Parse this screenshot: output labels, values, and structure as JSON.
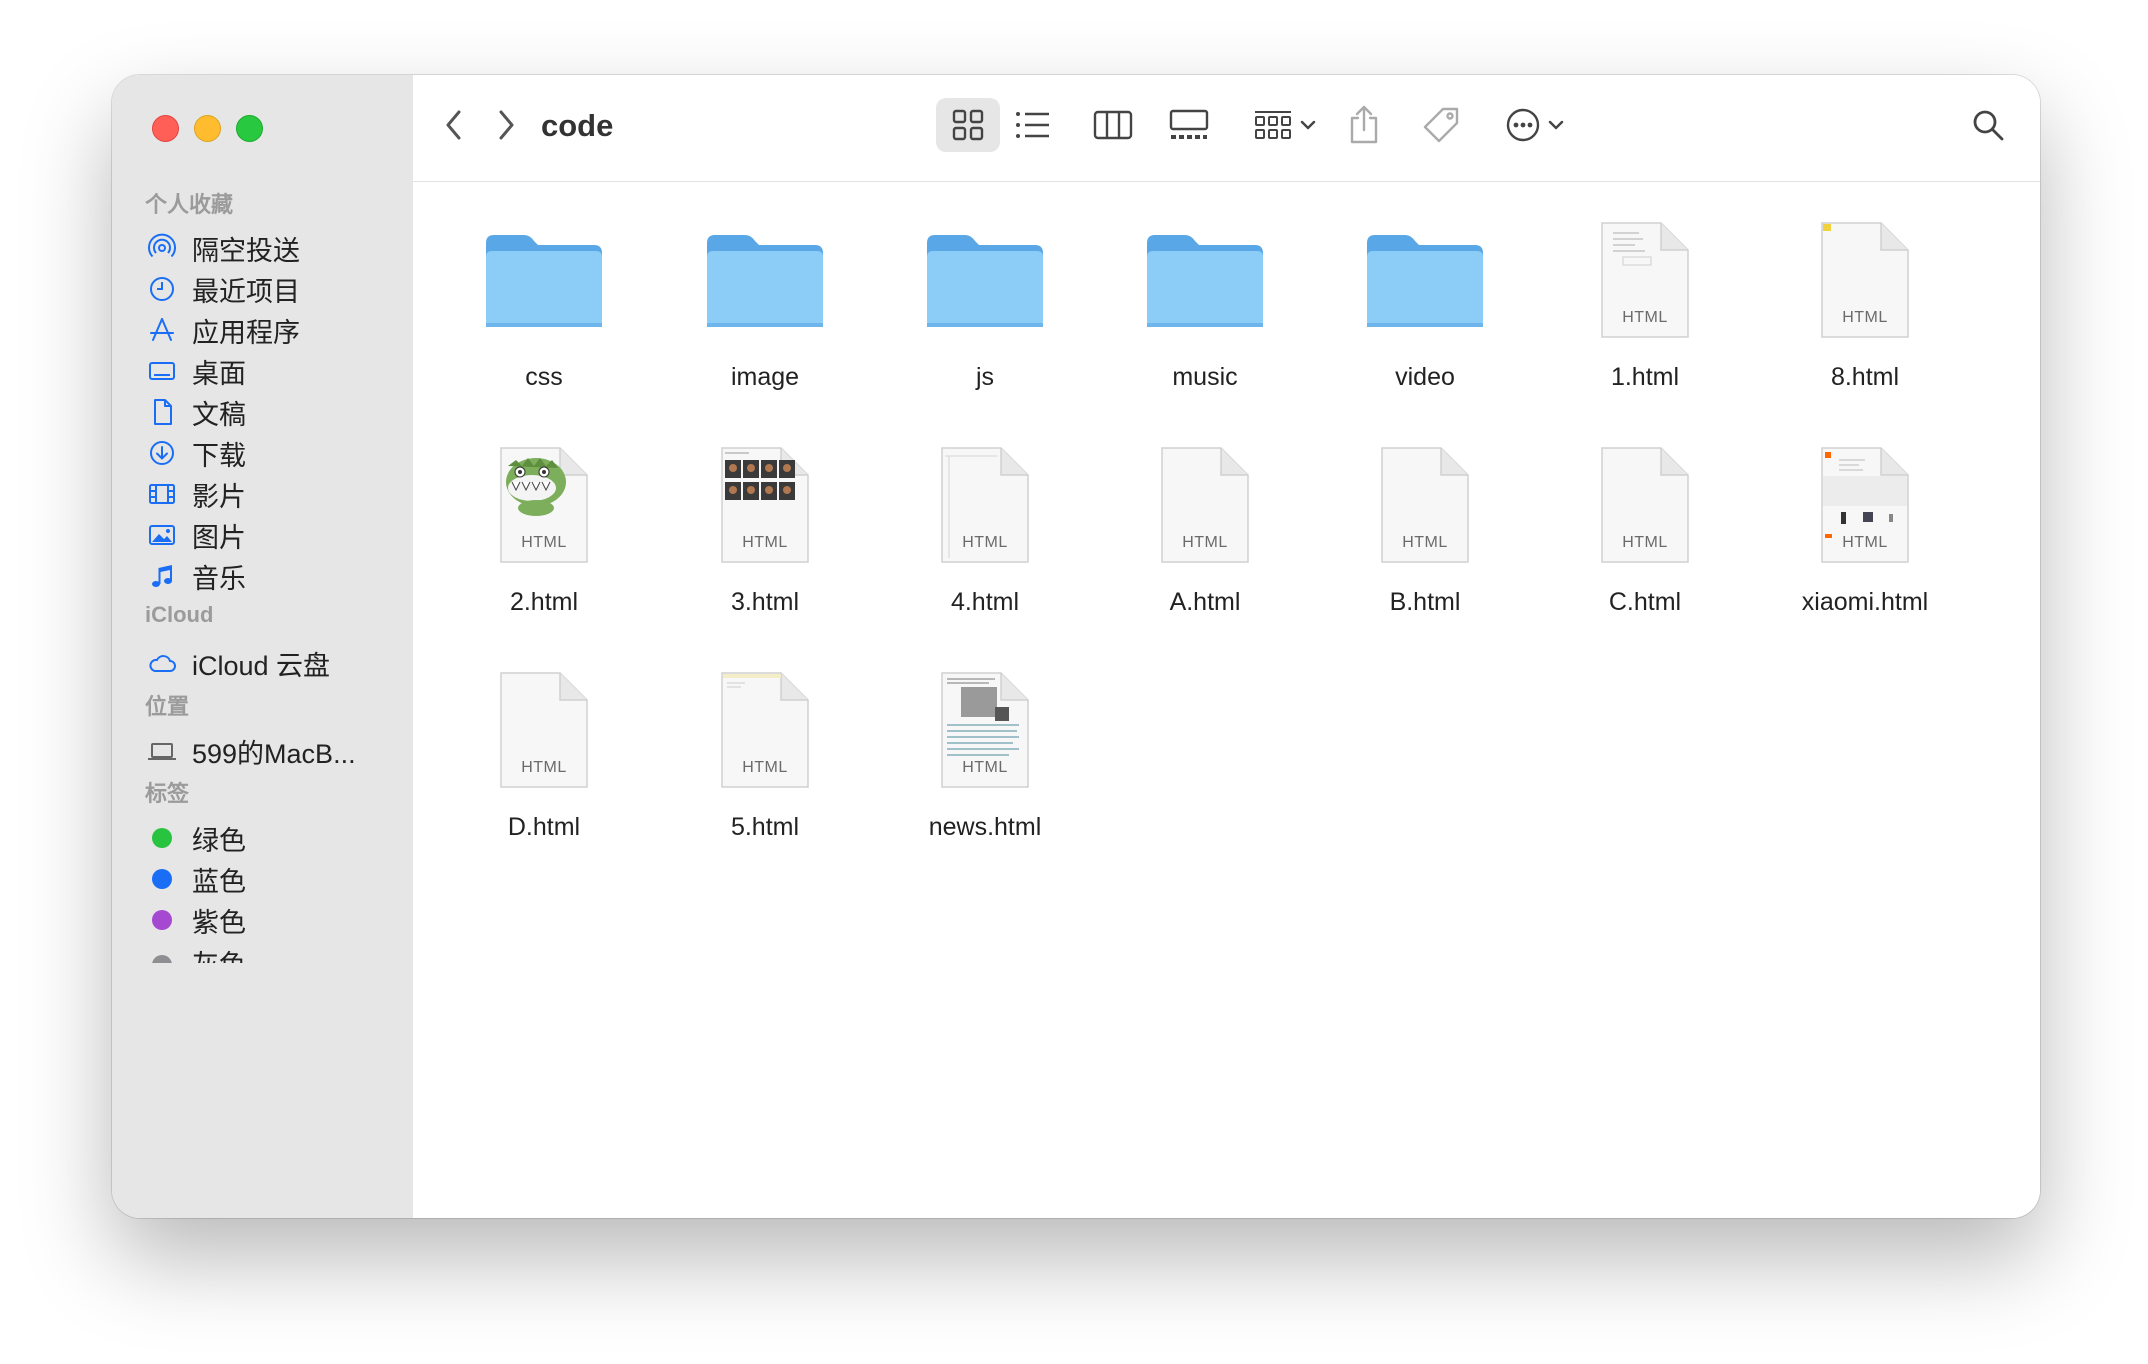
{
  "window": {
    "title": "code"
  },
  "sidebar": {
    "favorites_header": "个人收藏",
    "favorites": [
      {
        "label": "隔空投送",
        "icon": "airdrop-icon"
      },
      {
        "label": "最近项目",
        "icon": "clock-icon"
      },
      {
        "label": "应用程序",
        "icon": "applications-icon"
      },
      {
        "label": "桌面",
        "icon": "desktop-icon"
      },
      {
        "label": "文稿",
        "icon": "document-icon"
      },
      {
        "label": "下载",
        "icon": "download-icon"
      },
      {
        "label": "影片",
        "icon": "film-icon"
      },
      {
        "label": "图片",
        "icon": "photo-icon"
      },
      {
        "label": "音乐",
        "icon": "music-note-icon"
      }
    ],
    "icloud_header": "iCloud",
    "icloud": [
      {
        "label": "iCloud 云盘",
        "icon": "cloud-icon"
      }
    ],
    "locations_header": "位置",
    "locations": [
      {
        "label": "599的MacB...",
        "icon": "laptop-icon"
      }
    ],
    "tags_header": "标签",
    "tags": [
      {
        "label": "绿色",
        "color": "#28c33f"
      },
      {
        "label": "蓝色",
        "color": "#1a6ef5"
      },
      {
        "label": "紫色",
        "color": "#a549d1"
      },
      {
        "label": "灰色",
        "color": "#8e8e93"
      }
    ]
  },
  "toolbar": {
    "back_icon": "chevron-left-icon",
    "forward_icon": "chevron-right-icon",
    "path_title": "code",
    "views": [
      "icon-view-icon",
      "list-view-icon",
      "column-view-icon",
      "gallery-view-icon"
    ],
    "active_view": "icon-view-icon",
    "group_icon": "group-by-icon",
    "share_icon": "share-icon",
    "tag_icon": "tag-icon",
    "more_icon": "ellipsis-circle-icon",
    "search_icon": "search-icon"
  },
  "files": [
    {
      "name": "css",
      "kind": "folder"
    },
    {
      "name": "image",
      "kind": "folder"
    },
    {
      "name": "js",
      "kind": "folder"
    },
    {
      "name": "music",
      "kind": "folder"
    },
    {
      "name": "video",
      "kind": "folder"
    },
    {
      "name": "1.html",
      "kind": "html",
      "badge": "HTML",
      "preview": "text-lines"
    },
    {
      "name": "8.html",
      "kind": "html",
      "badge": "HTML",
      "preview": "yellow-corner"
    },
    {
      "name": "2.html",
      "kind": "html",
      "badge": "HTML",
      "preview": "dinosaur"
    },
    {
      "name": "3.html",
      "kind": "html",
      "badge": "HTML",
      "preview": "photo-grid"
    },
    {
      "name": "4.html",
      "kind": "html",
      "badge": "HTML",
      "preview": "frame"
    },
    {
      "name": "A.html",
      "kind": "html",
      "badge": "HTML",
      "preview": "blank"
    },
    {
      "name": "B.html",
      "kind": "html",
      "badge": "HTML",
      "preview": "blank"
    },
    {
      "name": "C.html",
      "kind": "html",
      "badge": "HTML",
      "preview": "blank"
    },
    {
      "name": "xiaomi.html",
      "kind": "html",
      "badge": "HTML",
      "preview": "store"
    },
    {
      "name": "D.html",
      "kind": "html",
      "badge": "HTML",
      "preview": "blank"
    },
    {
      "name": "5.html",
      "kind": "html",
      "badge": "HTML",
      "preview": "yellow-top"
    },
    {
      "name": "news.html",
      "kind": "html",
      "badge": "HTML",
      "preview": "news"
    }
  ],
  "colors": {
    "folder_front": "#8ccdf7",
    "folder_back": "#59a7e6",
    "sidebar_bg": "#e6e6e6",
    "accent": "#1a6ef5"
  }
}
